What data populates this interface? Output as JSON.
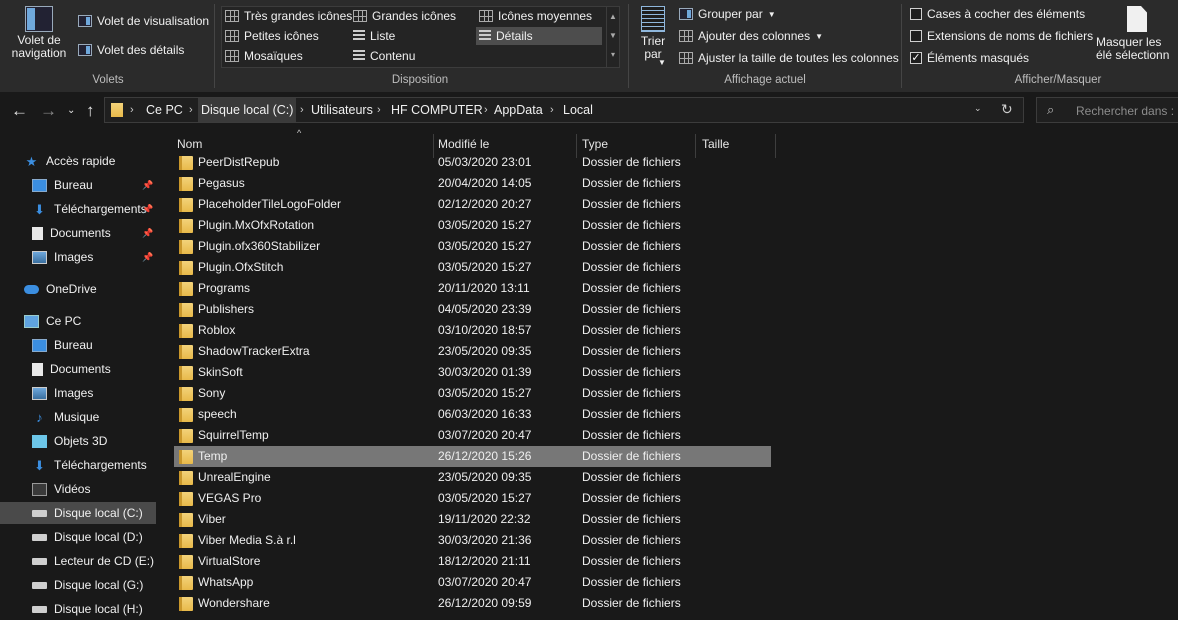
{
  "ribbon": {
    "panes": {
      "nav_pane": "Volet de navigation",
      "preview": "Volet de visualisation",
      "details": "Volet des détails",
      "group": "Volets"
    },
    "layout": {
      "items": [
        "Très grandes icônes",
        "Grandes icônes",
        "Icônes moyennes",
        "Petites icônes",
        "Liste",
        "Détails",
        "Mosaïques",
        "Contenu"
      ],
      "selected": "Détails",
      "group": "Disposition"
    },
    "current_view": {
      "sort": "Trier par",
      "group_by": "Grouper par",
      "add_columns": "Ajouter des colonnes",
      "fit_columns": "Ajuster la taille de toutes les colonnes",
      "group": "Affichage actuel"
    },
    "show_hide": {
      "checkboxes": "Cases à cocher des éléments",
      "extensions": "Extensions de noms de fichiers",
      "hidden": "Éléments masqués",
      "hide_selected": "Masquer les élé sélectionn",
      "group": "Afficher/Masquer",
      "checkboxes_checked": false,
      "extensions_checked": false,
      "hidden_checked": true
    }
  },
  "address": {
    "crumbs": [
      "Ce PC",
      "Disque local (C:)",
      "Utilisateurs",
      "HF COMPUTER",
      "AppData",
      "Local"
    ],
    "search_placeholder": "Rechercher dans : L"
  },
  "sidebar": {
    "items": [
      {
        "label": "Accès rapide",
        "icon": "star-icon",
        "pinned": false
      },
      {
        "label": "Bureau",
        "icon": "desktop-icon",
        "pinned": true
      },
      {
        "label": "Téléchargements",
        "icon": "download-icon",
        "pinned": true
      },
      {
        "label": "Documents",
        "icon": "document-icon",
        "pinned": true
      },
      {
        "label": "Images",
        "icon": "image-icon",
        "pinned": true
      },
      {
        "label": "OneDrive",
        "icon": "cloud-icon",
        "pinned": false
      },
      {
        "label": "Ce PC",
        "icon": "computer-icon",
        "pinned": false
      },
      {
        "label": "Bureau",
        "icon": "desktop-icon",
        "pinned": false
      },
      {
        "label": "Documents",
        "icon": "document-icon",
        "pinned": false
      },
      {
        "label": "Images",
        "icon": "image-icon",
        "pinned": false
      },
      {
        "label": "Musique",
        "icon": "music-icon",
        "pinned": false
      },
      {
        "label": "Objets 3D",
        "icon": "cube-icon",
        "pinned": false
      },
      {
        "label": "Téléchargements",
        "icon": "download-icon",
        "pinned": false
      },
      {
        "label": "Vidéos",
        "icon": "video-icon",
        "pinned": false
      },
      {
        "label": "Disque local (C:)",
        "icon": "drive-icon",
        "pinned": false
      },
      {
        "label": "Disque local (D:)",
        "icon": "drive-icon",
        "pinned": false
      },
      {
        "label": "Lecteur de CD (E:)",
        "icon": "cd-drive-icon",
        "pinned": false
      },
      {
        "label": "Disque local (G:)",
        "icon": "drive-icon",
        "pinned": false
      },
      {
        "label": "Disque local (H:)",
        "icon": "drive-icon",
        "pinned": false
      }
    ],
    "selected": "Disque local (C:)"
  },
  "columns": [
    "Nom",
    "Modifié le",
    "Type",
    "Taille"
  ],
  "files": [
    {
      "name": "PeerDistRepub",
      "modified": "05/03/2020 23:01",
      "type": "Dossier de fichiers"
    },
    {
      "name": "Pegasus",
      "modified": "20/04/2020 14:05",
      "type": "Dossier de fichiers"
    },
    {
      "name": "PlaceholderTileLogoFolder",
      "modified": "02/12/2020 20:27",
      "type": "Dossier de fichiers"
    },
    {
      "name": "Plugin.MxOfxRotation",
      "modified": "03/05/2020 15:27",
      "type": "Dossier de fichiers"
    },
    {
      "name": "Plugin.ofx360Stabilizer",
      "modified": "03/05/2020 15:27",
      "type": "Dossier de fichiers"
    },
    {
      "name": "Plugin.OfxStitch",
      "modified": "03/05/2020 15:27",
      "type": "Dossier de fichiers"
    },
    {
      "name": "Programs",
      "modified": "20/11/2020 13:11",
      "type": "Dossier de fichiers"
    },
    {
      "name": "Publishers",
      "modified": "04/05/2020 23:39",
      "type": "Dossier de fichiers"
    },
    {
      "name": "Roblox",
      "modified": "03/10/2020 18:57",
      "type": "Dossier de fichiers"
    },
    {
      "name": "ShadowTrackerExtra",
      "modified": "23/05/2020 09:35",
      "type": "Dossier de fichiers"
    },
    {
      "name": "SkinSoft",
      "modified": "30/03/2020 01:39",
      "type": "Dossier de fichiers"
    },
    {
      "name": "Sony",
      "modified": "03/05/2020 15:27",
      "type": "Dossier de fichiers"
    },
    {
      "name": "speech",
      "modified": "06/03/2020 16:33",
      "type": "Dossier de fichiers"
    },
    {
      "name": "SquirrelTemp",
      "modified": "03/07/2020 20:47",
      "type": "Dossier de fichiers"
    },
    {
      "name": "Temp",
      "modified": "26/12/2020 15:26",
      "type": "Dossier de fichiers"
    },
    {
      "name": "UnrealEngine",
      "modified": "23/05/2020 09:35",
      "type": "Dossier de fichiers"
    },
    {
      "name": "VEGAS Pro",
      "modified": "03/05/2020 15:27",
      "type": "Dossier de fichiers"
    },
    {
      "name": "Viber",
      "modified": "19/11/2020 22:32",
      "type": "Dossier de fichiers"
    },
    {
      "name": "Viber Media S.à r.l",
      "modified": "30/03/2020 21:36",
      "type": "Dossier de fichiers"
    },
    {
      "name": "VirtualStore",
      "modified": "18/12/2020 21:11",
      "type": "Dossier de fichiers"
    },
    {
      "name": "WhatsApp",
      "modified": "03/07/2020 20:47",
      "type": "Dossier de fichiers"
    },
    {
      "name": "Wondershare",
      "modified": "26/12/2020 09:59",
      "type": "Dossier de fichiers"
    }
  ],
  "selected_file": "Temp",
  "colors": {
    "background": "#191919",
    "ribbon": "#2b2b2b",
    "selection": "#777777",
    "folder": "#e8b94a",
    "accent": "#3b8ee0"
  }
}
